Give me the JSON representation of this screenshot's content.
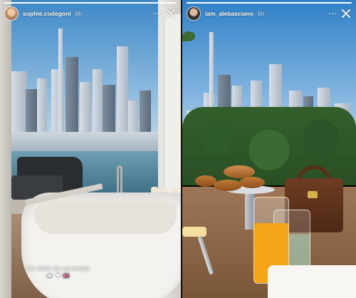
{
  "stories": {
    "left": {
      "username": "sophie.codegoni",
      "time_ago": "6h",
      "progress": 1.0,
      "caption_text": "No vabbè che meraviglia",
      "caption_emoji": "☁️ ♥ 🇬🇧"
    },
    "right": {
      "username": "iam_alebasciano",
      "time_ago": "5h",
      "progress": 1.0
    }
  },
  "icons": {
    "more": "⋯",
    "close": "close-icon"
  },
  "colors": {
    "progress_track": "rgba(255,255,255,0.45)",
    "progress_fill": "#ffffff",
    "text": "#ffffff"
  }
}
